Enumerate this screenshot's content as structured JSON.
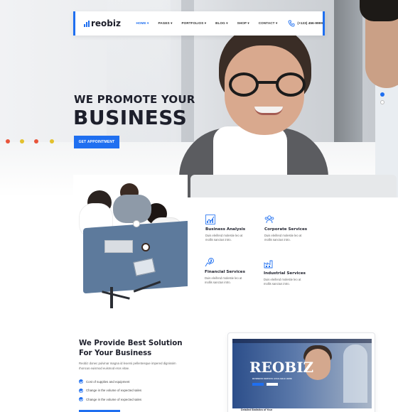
{
  "nav": {
    "logo": "reobiz",
    "menu": [
      {
        "label": "HOME",
        "active": true
      },
      {
        "label": "PAGES",
        "active": false
      },
      {
        "label": "PORTFOLIOS",
        "active": false
      },
      {
        "label": "BLOG",
        "active": false
      },
      {
        "label": "SHOP",
        "active": false
      },
      {
        "label": "CONTACT",
        "active": false
      }
    ],
    "phone": "(+123) 456-9999",
    "accent": "#1f6ff0"
  },
  "hero": {
    "line1": "WE PROMOTE YOUR",
    "line2": "BUSINESS",
    "cta": "GET APPOINTMENT"
  },
  "services": [
    {
      "icon": "chart-icon",
      "title": "Business Analysis",
      "desc": "Duis eleifend molestie leo at mollis sanctus intro."
    },
    {
      "icon": "users-icon",
      "title": "Corporate Services",
      "desc": "Duis eleifend molestie leo at mollis sanctus intro."
    },
    {
      "icon": "money-icon",
      "title": "Financial Services",
      "desc": "Duis eleifend molestie leo at mollis sanctus intro."
    },
    {
      "icon": "factory-icon",
      "title": "Industrial Services",
      "desc": "Duis eleifend molestie leo at mollis sanctus intro."
    }
  ],
  "solution": {
    "title_line1": "We Provide Best Solution",
    "title_line2": "For Your Business",
    "desc": "Reobiz donec pulvinar magna id leoersi pellentesque impered dignissim rhoncus euismod euismod eros vitae.",
    "checklist": [
      "Cost of supplies and equipment",
      "Change in the volume of expected sales",
      "Change in the volume of expected sales"
    ]
  },
  "preview": {
    "brand": "REOBIZ",
    "subtitle": "BUSINESS SERVICE AVAILABLE HERE",
    "bottom_title": "Detailed Statistics of Your"
  }
}
